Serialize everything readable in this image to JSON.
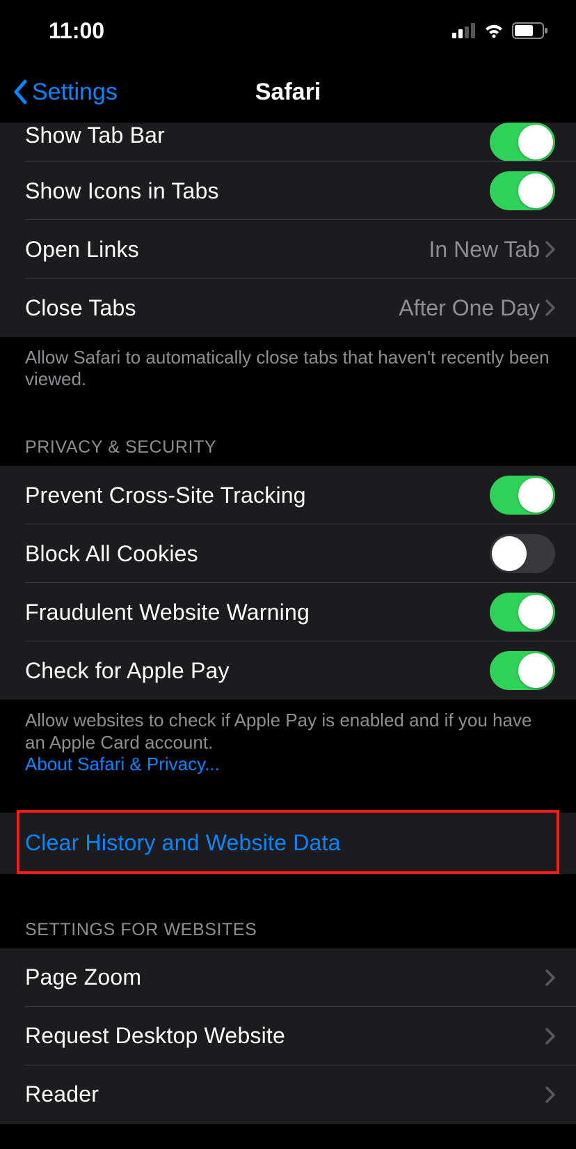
{
  "status": {
    "time": "11:00"
  },
  "nav": {
    "back_label": "Settings",
    "title": "Safari"
  },
  "tabs_section": {
    "show_tab_bar": {
      "label": "Show Tab Bar",
      "on": true
    },
    "show_icons": {
      "label": "Show Icons in Tabs",
      "on": true
    },
    "open_links": {
      "label": "Open Links",
      "value": "In New Tab"
    },
    "close_tabs": {
      "label": "Close Tabs",
      "value": "After One Day"
    },
    "footer": "Allow Safari to automatically close tabs that haven't recently been viewed."
  },
  "privacy_section": {
    "header": "PRIVACY & SECURITY",
    "prevent_tracking": {
      "label": "Prevent Cross-Site Tracking",
      "on": true
    },
    "block_cookies": {
      "label": "Block All Cookies",
      "on": false
    },
    "fraud_warning": {
      "label": "Fraudulent Website Warning",
      "on": true
    },
    "check_apple_pay": {
      "label": "Check for Apple Pay",
      "on": true
    },
    "footer_text": "Allow websites to check if Apple Pay is enabled and if you have an Apple Card account.",
    "footer_link": "About Safari & Privacy..."
  },
  "clear_section": {
    "clear_history": "Clear History and Website Data"
  },
  "websites_section": {
    "header": "SETTINGS FOR WEBSITES",
    "page_zoom": {
      "label": "Page Zoom"
    },
    "request_desktop": {
      "label": "Request Desktop Website"
    },
    "reader": {
      "label": "Reader"
    }
  },
  "colors": {
    "accent": "#0a84ff",
    "toggle_on": "#30d158",
    "highlight": "#ff1a1a"
  }
}
